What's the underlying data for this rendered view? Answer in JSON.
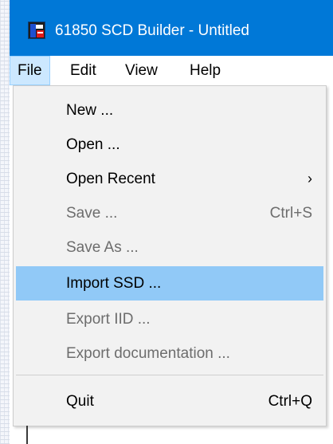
{
  "window": {
    "title": "61850 SCD Builder - Untitled",
    "title_bar_color": "#0078d7",
    "app_icon": "scd-builder-app-icon"
  },
  "menubar": {
    "items": [
      {
        "label": "File",
        "active": true
      },
      {
        "label": "Edit",
        "active": false
      },
      {
        "label": "View",
        "active": false
      },
      {
        "label": "Help",
        "active": false
      }
    ]
  },
  "file_menu": {
    "items": [
      {
        "label": "New ...",
        "shortcut": "",
        "enabled": true,
        "submenu": false
      },
      {
        "label": "Open ...",
        "shortcut": "",
        "enabled": true,
        "submenu": false
      },
      {
        "label": "Open Recent",
        "shortcut": "",
        "enabled": true,
        "submenu": true,
        "arrow": "›"
      },
      {
        "label": "Save ...",
        "shortcut": "Ctrl+S",
        "enabled": false,
        "submenu": false
      },
      {
        "label": "Save As ...",
        "shortcut": "",
        "enabled": false,
        "submenu": false
      },
      {
        "label": "Import SSD ...",
        "shortcut": "",
        "enabled": true,
        "submenu": false,
        "highlighted": true
      },
      {
        "label": "Export IID ...",
        "shortcut": "",
        "enabled": false,
        "submenu": false
      },
      {
        "label": "Export documentation ...",
        "shortcut": "",
        "enabled": false,
        "submenu": false
      },
      {
        "label": "Quit",
        "shortcut": "Ctrl+Q",
        "enabled": true,
        "submenu": false
      }
    ],
    "highlight_color": "#91c9f7"
  }
}
